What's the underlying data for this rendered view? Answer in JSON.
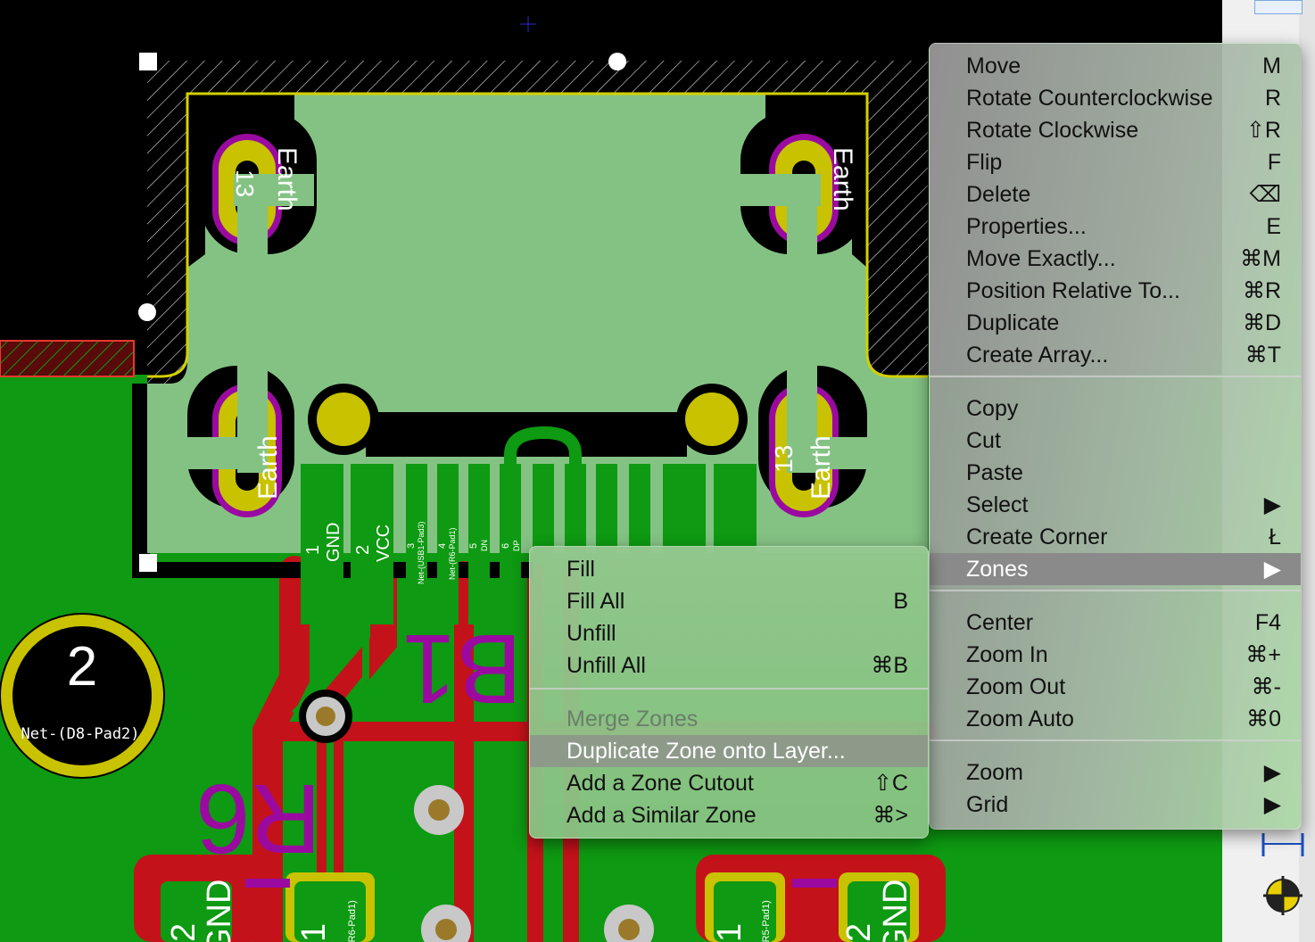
{
  "board": {
    "footprint_label": "Net-(D8-Pad2)",
    "pad_number_big": "2",
    "ref_b1": "B1",
    "ref_r6": "R6",
    "pads": [
      "1",
      "2",
      "3",
      "4",
      "5",
      "6"
    ],
    "pad_nets": [
      "GND",
      "VCC",
      "Net-(USB1-Pad3)",
      "Net-(R6-Pad1)",
      "DN",
      "DP"
    ],
    "earth_label": "Earth",
    "pad13": "13",
    "bottom_left": [
      "2",
      "GND",
      "1",
      "(R6-Pad1)"
    ],
    "bottom_right": [
      "1",
      "(R5-Pad1)",
      "2",
      "GND"
    ]
  },
  "context_menu": {
    "items": [
      {
        "label": "Move",
        "shortcut": "M"
      },
      {
        "label": "Rotate Counterclockwise",
        "shortcut": "R"
      },
      {
        "label": "Rotate Clockwise",
        "shortcut": "⇧R"
      },
      {
        "label": "Flip",
        "shortcut": "F"
      },
      {
        "label": "Delete",
        "shortcut": "⌫"
      },
      {
        "label": "Properties...",
        "shortcut": "E"
      },
      {
        "label": "Move Exactly...",
        "shortcut": "⌘M"
      },
      {
        "label": "Position Relative To...",
        "shortcut": "⌘R"
      },
      {
        "label": "Duplicate",
        "shortcut": "⌘D"
      },
      {
        "label": "Create Array...",
        "shortcut": "⌘T"
      },
      {
        "label": "Copy",
        "shortcut": ""
      },
      {
        "label": "Cut",
        "shortcut": ""
      },
      {
        "label": "Paste",
        "shortcut": ""
      },
      {
        "label": "Select",
        "shortcut": "▶"
      },
      {
        "label": "Create Corner",
        "shortcut": "Ł"
      },
      {
        "label": "Zones",
        "shortcut": "▶"
      },
      {
        "label": "Center",
        "shortcut": "F4"
      },
      {
        "label": "Zoom In",
        "shortcut": "⌘+"
      },
      {
        "label": "Zoom Out",
        "shortcut": "⌘-"
      },
      {
        "label": "Zoom Auto",
        "shortcut": "⌘0"
      },
      {
        "label": "Zoom",
        "shortcut": "▶"
      },
      {
        "label": "Grid",
        "shortcut": "▶"
      }
    ]
  },
  "zones_submenu": {
    "items": [
      {
        "label": "Fill",
        "shortcut": ""
      },
      {
        "label": "Fill All",
        "shortcut": "B"
      },
      {
        "label": "Unfill",
        "shortcut": ""
      },
      {
        "label": "Unfill All",
        "shortcut": "⌘B"
      },
      {
        "label": "Merge Zones",
        "shortcut": ""
      },
      {
        "label": "Duplicate Zone onto Layer...",
        "shortcut": ""
      },
      {
        "label": "Add a Zone Cutout",
        "shortcut": "⇧C"
      },
      {
        "label": "Add a Similar Zone",
        "shortcut": "⌘>"
      }
    ]
  },
  "colors": {
    "copper_front": "#e43a2e",
    "copper_green": "#0e9a12",
    "zone_fill": "#84c284",
    "pad_yellow": "#c8c200",
    "outline_yellow": "#d4d000",
    "silkscreen": "#ffffff",
    "fab_purple": "#9a0aa0"
  }
}
